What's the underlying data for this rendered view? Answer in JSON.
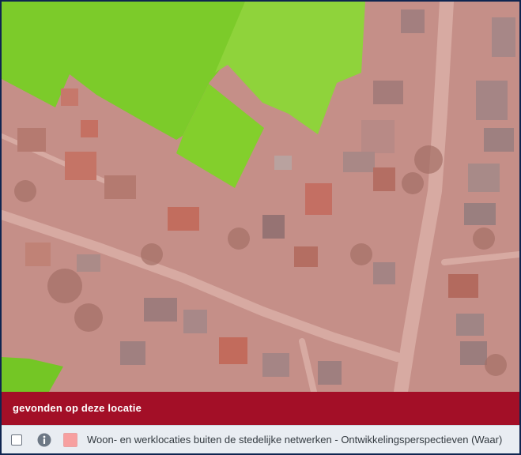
{
  "map": {
    "layer_label": "Woon- en werklocaties buiten de stedelijke netwerken - Ontwikkelingsperspectieven (Waar)"
  },
  "result_bar": {
    "title": "gevonden op deze locatie"
  },
  "legend": {
    "items": [
      {
        "label": "Woon- en werklocaties buiten de stedelijke netwerken - Ontwikkelingsperspectieven (Waar)",
        "swatch_color": "#f7a0a0",
        "checked": false,
        "icon": "info-icon"
      }
    ]
  },
  "colors": {
    "overlay_pink": "#c58f88",
    "green_zone": "#7cd11f",
    "header_red": "#a30f27",
    "frame_border": "#0f2550"
  }
}
